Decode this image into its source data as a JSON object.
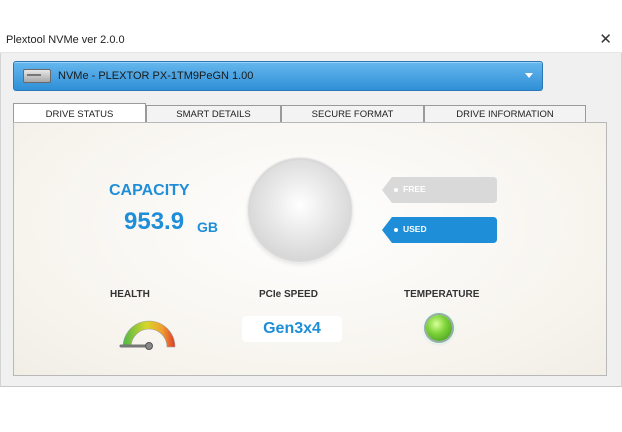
{
  "window": {
    "title": "Plextool NVMe ver 2.0.0",
    "close_glyph": "✕"
  },
  "drive_select": {
    "value": "NVMe - PLEXTOR PX-1TM9PeGN 1.00",
    "icon": "drive-icon"
  },
  "tabs": [
    {
      "label": "DRIVE STATUS",
      "active": true
    },
    {
      "label": "SMART DETAILS",
      "active": false
    },
    {
      "label": "SECURE FORMAT",
      "active": false
    },
    {
      "label": "DRIVE INFORMATION",
      "active": false
    }
  ],
  "capacity": {
    "label": "CAPACITY",
    "value": "953.9",
    "unit": "GB"
  },
  "legend": {
    "free": {
      "label": "FREE",
      "color": "#d9d9d9"
    },
    "used": {
      "label": "USED",
      "color": "#1f8ed8"
    }
  },
  "health": {
    "label": "HEALTH"
  },
  "pcie_speed": {
    "label": "PCIe SPEED",
    "value": "Gen3x4"
  },
  "temperature": {
    "label": "TEMPERATURE",
    "status_color": "#58c02a"
  },
  "colors": {
    "accent": "#1f8ed8"
  }
}
